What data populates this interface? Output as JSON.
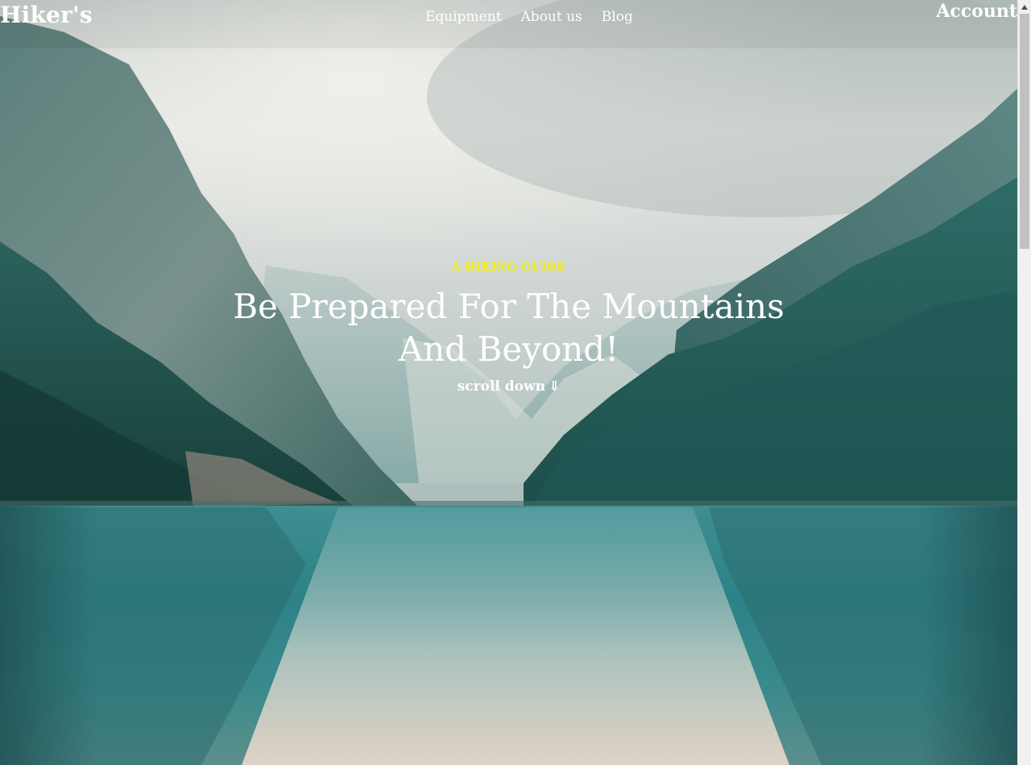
{
  "header": {
    "brand": "Hiker's",
    "nav": [
      {
        "label": "Equipment"
      },
      {
        "label": "About us"
      },
      {
        "label": "Blog"
      }
    ],
    "account": "Account"
  },
  "hero": {
    "eyebrow": "A HIKING GUIDE",
    "headline": "Be Prepared For The Mountains And Beyond!",
    "scroll_label": "scroll down",
    "scroll_icon": "double-arrow-down-icon"
  },
  "colors": {
    "eyebrow": "#f5f000",
    "text": "#ffffff",
    "lake": "#2f8a8e",
    "sky": "#dfe3df"
  }
}
